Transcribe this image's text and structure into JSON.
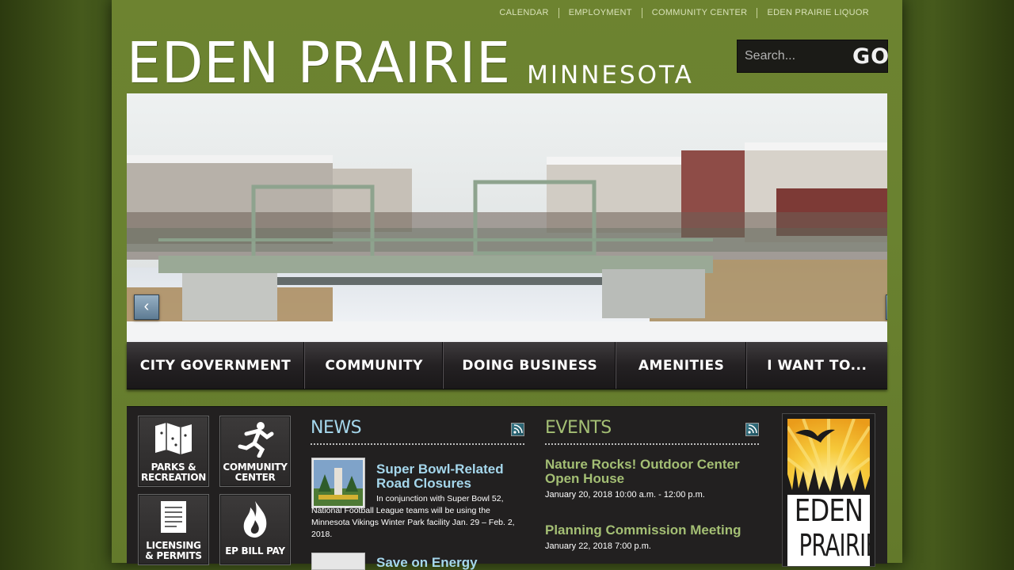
{
  "top_links": [
    "CALENDAR",
    "EMPLOYMENT",
    "COMMUNITY CENTER",
    "EDEN PRAIRIE LIQUOR"
  ],
  "logo": {
    "main": "EDEN PRAIRIE",
    "sub": "MINNESOTA"
  },
  "search": {
    "placeholder": "Search...",
    "go_label": "GO"
  },
  "slider": {
    "prev_icon": "chevron-left-icon",
    "next_icon": "chevron-right-icon"
  },
  "nav": [
    "CITY GOVERNMENT",
    "COMMUNITY",
    "DOING BUSINESS",
    "AMENITIES",
    "I WANT TO..."
  ],
  "quick_links": [
    {
      "line1": "PARKS &",
      "line2": "RECREATION",
      "icon": "map-icon"
    },
    {
      "line1": "COMMUNITY",
      "line2": "CENTER",
      "icon": "runner-icon"
    },
    {
      "line1": "LICENSING",
      "line2": "& PERMITS",
      "icon": "document-icon"
    },
    {
      "line1": "EP BILL PAY",
      "line2": "",
      "icon": "flame-icon"
    }
  ],
  "news": {
    "heading": "NEWS",
    "items": [
      {
        "title": "Super Bowl-Related Road Closures",
        "body": "In conjunction with Super Bowl 52, National Football League teams will be using the Minnesota Vikings Winter Park facility Jan. 29 – Feb. 2, 2018."
      },
      {
        "title": "Save on Energy",
        "body": ""
      }
    ]
  },
  "events": {
    "heading": "EVENTS",
    "items": [
      {
        "title": "Nature Rocks! Outdoor Center Open House",
        "date": "January 20, 2018 10:00 a.m. - 12:00 p.m."
      },
      {
        "title": "Planning Commission Meeting",
        "date": "January 22, 2018 7:00 p.m."
      }
    ]
  },
  "badge": {
    "line1": "EDEN",
    "line2": "PRAIRIE"
  },
  "colors": {
    "olive": "#6a8230",
    "news_head": "#a5d7ec",
    "events_head": "#a4bf74",
    "panel": "#222020"
  }
}
